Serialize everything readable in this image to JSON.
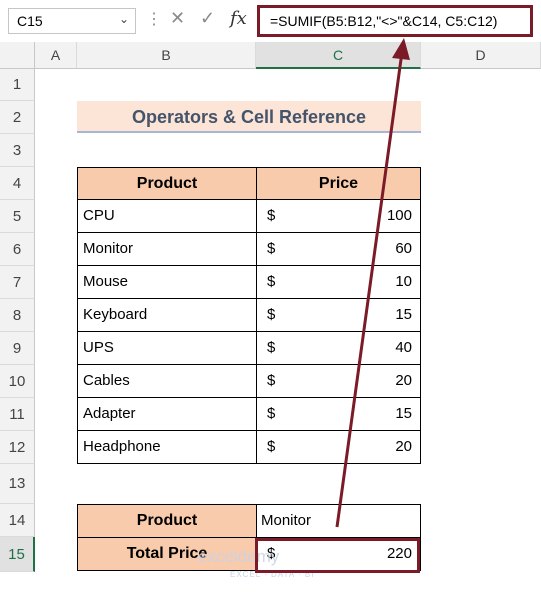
{
  "formula_bar": {
    "name_box": "C15",
    "name_box_dropdown_icon": "chevron-down-icon",
    "cancel_icon": "cross-icon",
    "enter_icon": "check-icon",
    "fx_label": "fx",
    "formula": "=SUMIF(B5:B12,\"<>\"&C14, C5:C12)"
  },
  "columns": [
    "A",
    "B",
    "C",
    "D"
  ],
  "selected_column": "C",
  "rows": [
    "1",
    "2",
    "3",
    "4",
    "5",
    "6",
    "7",
    "8",
    "9",
    "10",
    "11",
    "12",
    "13",
    "14",
    "15"
  ],
  "selected_row": "15",
  "title": "Operators & Cell Reference",
  "table": {
    "headers": [
      "Product",
      "Price"
    ],
    "rows": [
      {
        "product": "CPU",
        "currency": "$",
        "price": "100"
      },
      {
        "product": "Monitor",
        "currency": "$",
        "price": "60"
      },
      {
        "product": "Mouse",
        "currency": "$",
        "price": "10"
      },
      {
        "product": "Keyboard",
        "currency": "$",
        "price": "15"
      },
      {
        "product": "UPS",
        "currency": "$",
        "price": "40"
      },
      {
        "product": "Cables",
        "currency": "$",
        "price": "20"
      },
      {
        "product": "Adapter",
        "currency": "$",
        "price": "15"
      },
      {
        "product": "Headphone",
        "currency": "$",
        "price": "20"
      }
    ]
  },
  "criteria": {
    "product_label": "Product",
    "product_value": "Monitor",
    "total_label": "Total Price",
    "total_currency": "$",
    "total_value": "220"
  },
  "watermark": {
    "name": "exceldemy",
    "tagline": "EXCEL · DATA · BI"
  },
  "colors": {
    "accent": "#7a1b27",
    "header_fill": "#f8cbad",
    "title_fill": "#fce4d6",
    "selection": "#1e7145"
  }
}
